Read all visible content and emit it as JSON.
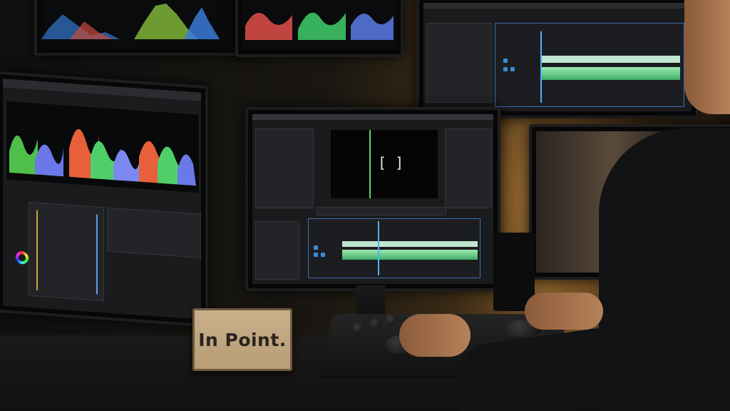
{
  "sign": {
    "text": "In Point."
  },
  "colors": {
    "accent_timeline": "#3b6fb0",
    "waveform_green": "#6fd18f",
    "playhead": "#4fb0ff",
    "wall_warm": "#7a5526"
  },
  "icons": [
    "color-wheel-icon",
    "bracket-icon"
  ]
}
